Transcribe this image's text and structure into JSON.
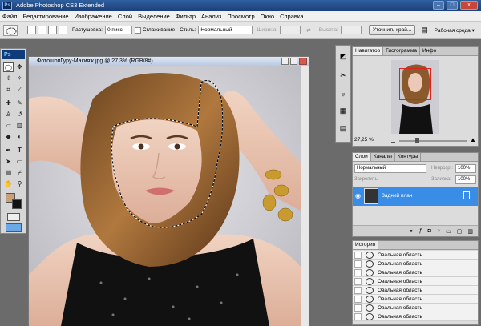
{
  "window": {
    "title": "Adobe Photoshop CS3 Extended",
    "min": "–",
    "max": "□",
    "close": "x",
    "logo": "Ps"
  },
  "menu": [
    "Файл",
    "Редактирование",
    "Изображение",
    "Слой",
    "Выделение",
    "Фильтр",
    "Анализ",
    "Просмотр",
    "Окно",
    "Справка"
  ],
  "options": {
    "feather_label": "Растушевка:",
    "feather_value": "0 пикс.",
    "antialias_label": "Сглаживание",
    "style_label": "Стиль:",
    "style_value": "Нормальный",
    "width_label": "Ширина:",
    "height_label": "Высота:",
    "refine_button": "Уточнить край...",
    "workspace": "Рабочая среда ▾"
  },
  "toolbox": {
    "badge": "Ps"
  },
  "document": {
    "title": "ФотошопГуру-Макияж.jpg @ 27,3% (RGB/8#)"
  },
  "navigator": {
    "tabs": [
      "Навигатор",
      "Гистограмма",
      "Инфо"
    ],
    "zoom": "27,25 %"
  },
  "layers": {
    "tabs": [
      "Слои",
      "Каналы",
      "Контуры"
    ],
    "blend_mode": "Нормальный",
    "opacity_label": "Непрозр.:",
    "opacity_value": "100%",
    "lock_label": "Закрепить:",
    "fill_label": "Заливка:",
    "fill_value": "100%",
    "layer_name": "Задний план"
  },
  "history": {
    "tab": "История",
    "items": [
      "Овальная область",
      "Овальная область",
      "Овальная область",
      "Овальная область",
      "Овальная область",
      "Овальная область",
      "Овальная область",
      "Овальная область"
    ]
  },
  "colors": {
    "accent": "#3a8de6",
    "title_bar": "#1c3f77"
  }
}
